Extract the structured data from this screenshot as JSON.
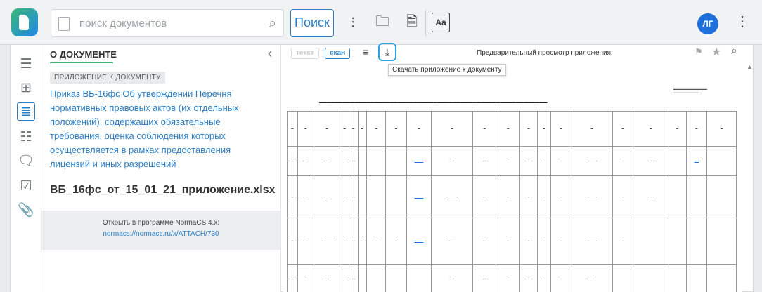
{
  "header": {
    "search_placeholder": "поиск документов",
    "search_button": "Поиск",
    "aa_label": "Aa",
    "avatar_initials": "ЛГ"
  },
  "panel": {
    "title": "О ДОКУМЕНТЕ",
    "badge": "ПРИЛОЖЕНИЕ К ДОКУМЕНТУ",
    "doc_link": "Приказ ВБ-16фс Об утверждении Перечня нормативных правовых актов (их отдельных положений), содержащих обязательные требования, оценка соблюдения которых осуществляется в рамках предоставления лицензий и иных разрешений",
    "file_name": "ВБ_16фс_от_15_01_21_приложение.xlsx",
    "open_label": "Открыть в программе NormaCS 4.x:",
    "open_link": "normacs://normacs.ru/x/ATTACH/730"
  },
  "viewer": {
    "btn_text": "текст",
    "btn_scan": "скан",
    "title": "Предварительный просмотр приложения.",
    "tooltip": "Скачать приложение к документу"
  }
}
